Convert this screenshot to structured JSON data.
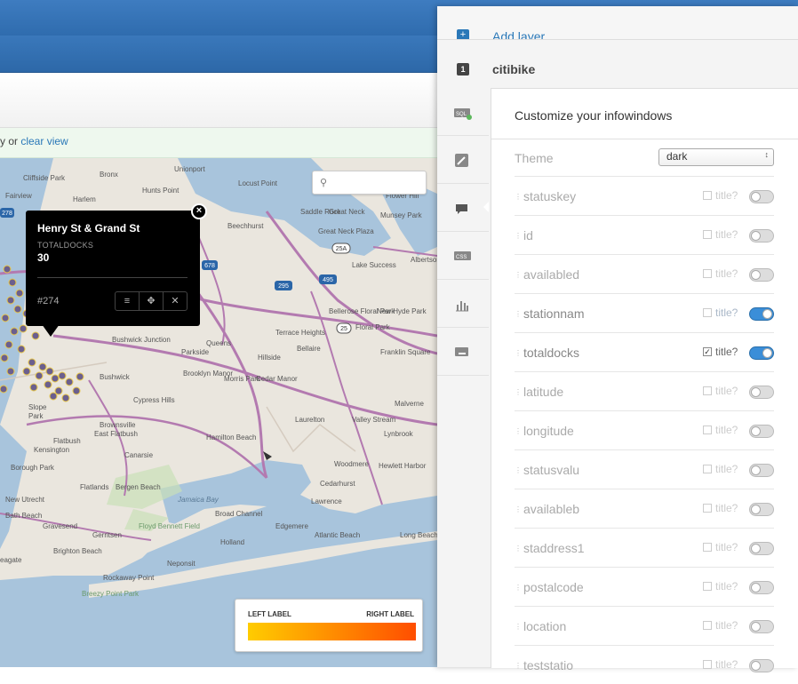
{
  "filter_bar": {
    "prefix": "y or ",
    "link": "clear view"
  },
  "map": {
    "labels": [
      "Cliffside Park",
      "Fairview",
      "Bronx",
      "Unionport",
      "Locust Point",
      "Harlem",
      "Hunts Point",
      "Flower Hill",
      "Saddle Rock",
      "Great Neck",
      "Munsey Park",
      "Beechhurst",
      "Great Neck Plaza",
      "Albertson",
      "Lake Success",
      "Bellerose Floral Park",
      "New Hyde Park",
      "Floral Park",
      "Terrace Heights",
      "Bellaire",
      "Franklin Square",
      "Bushwick Junction",
      "Queens",
      "Parkside",
      "Hillside",
      "Bushwick",
      "Brooklyn Manor",
      "Morris Park",
      "Cedar Manor",
      "Cypress Hills",
      "Slope",
      "Park",
      "Brownsville",
      "East Flatbush",
      "Flatbush",
      "Kensington",
      "Canarsie",
      "Hamilton Beach",
      "Laurelton",
      "Valley Stream",
      "Lynbrook",
      "Malverne",
      "Borough Park",
      "Woodmere",
      "Hewlett Harbor",
      "Flatlands",
      "Bergen Beach",
      "Cedarhurst",
      "New Utrecht",
      "Bath Beach",
      "Jamaica Bay",
      "Broad Channel",
      "Lawrence",
      "Gravesend",
      "Gerritsen",
      "Floyd Bennett Field",
      "Edgemere",
      "Atlantic Beach",
      "Long Beach",
      "Brighton Beach",
      "Holland",
      "eagate",
      "Neponsit",
      "Rockaway Point",
      "Breezy Point Park"
    ],
    "highway_labels": [
      "678",
      "295",
      "495",
      "25A",
      "25",
      "278"
    ]
  },
  "infowindow": {
    "title": "Henry St & Grand St",
    "field_label": "TOTALDOCKS",
    "field_value": "30",
    "id_text": "#274"
  },
  "legend": {
    "left_label": "LEFT LABEL",
    "right_label": "RIGHT LABEL",
    "color_start": "#ffcc00",
    "color_end": "#ff4e00"
  },
  "panel": {
    "add_layer": "Add layer",
    "layer_number": "1",
    "layer_name": "citibike",
    "title": "Customize your infowindows",
    "theme_label": "Theme",
    "theme_value": "dark",
    "title_check_label": "title?",
    "sidebar_icons": [
      "sql-icon",
      "wizard-brush-icon",
      "infowindow-icon",
      "css-icon",
      "legend-icon",
      "tooltip-icon"
    ],
    "accent_color": "#3b8ed8",
    "fields": [
      {
        "name": "statuskey",
        "title": false,
        "on": false
      },
      {
        "name": "id",
        "title": false,
        "on": false
      },
      {
        "name": "availabled",
        "title": false,
        "on": false
      },
      {
        "name": "stationnam",
        "title": false,
        "on": true
      },
      {
        "name": "totaldocks",
        "title": true,
        "on": true
      },
      {
        "name": "latitude",
        "title": false,
        "on": false
      },
      {
        "name": "longitude",
        "title": false,
        "on": false
      },
      {
        "name": "statusvalu",
        "title": false,
        "on": false
      },
      {
        "name": "availableb",
        "title": false,
        "on": false
      },
      {
        "name": "staddress1",
        "title": false,
        "on": false
      },
      {
        "name": "postalcode",
        "title": false,
        "on": false
      },
      {
        "name": "location",
        "title": false,
        "on": false
      },
      {
        "name": "teststatio",
        "title": false,
        "on": false
      }
    ]
  }
}
